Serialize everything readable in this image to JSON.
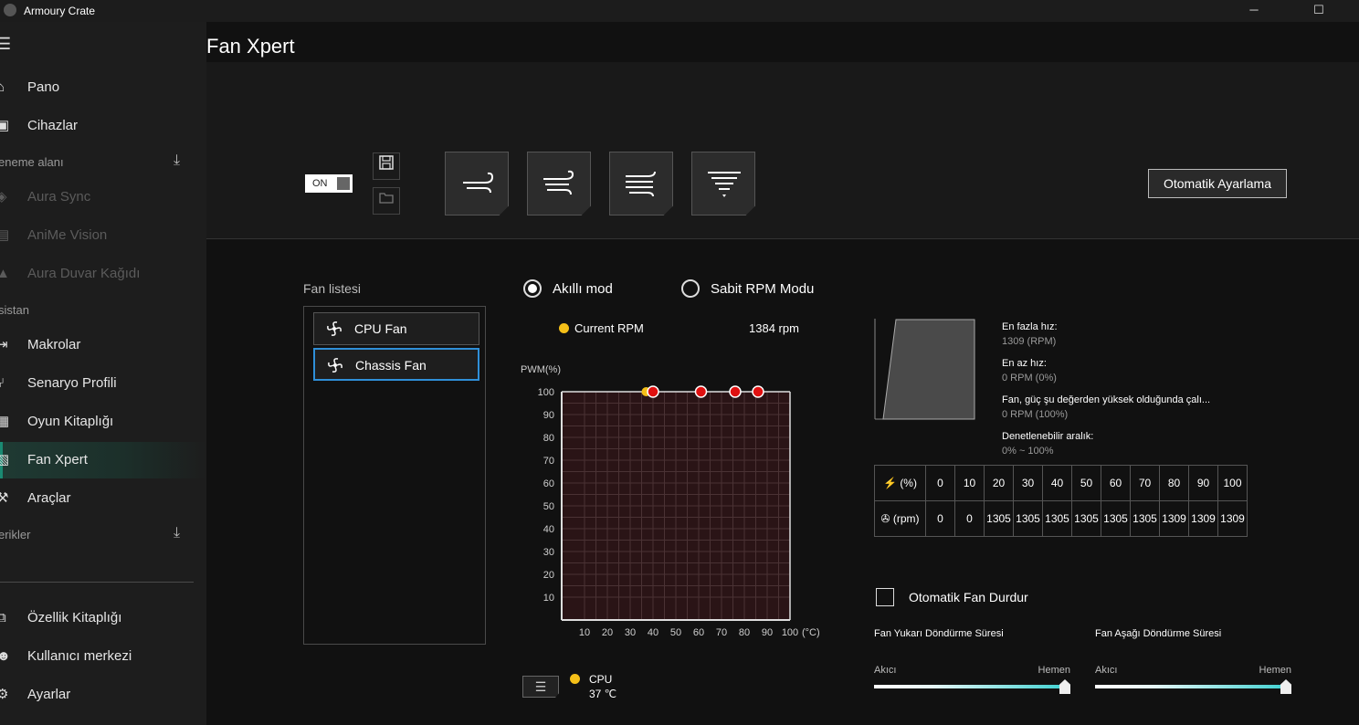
{
  "titlebar": {
    "app_title": "Armoury Crate",
    "minimize": "─",
    "maximize": "☐",
    "close": "✕"
  },
  "sidebar": {
    "items": [
      {
        "label": "Pano",
        "icon": "home-icon",
        "disabled": false
      },
      {
        "label": "Cihazlar",
        "icon": "devices-icon",
        "disabled": false
      },
      {
        "label": "Aura Sync",
        "icon": "aura-icon",
        "disabled": true
      },
      {
        "label": "AniMe Vision",
        "icon": "anime-icon",
        "disabled": true
      },
      {
        "label": "Aura Duvar Kağıdı",
        "icon": "wallpaper-icon",
        "disabled": true
      },
      {
        "label": "Makrolar",
        "icon": "macro-icon",
        "disabled": false
      },
      {
        "label": "Senaryo Profili",
        "icon": "scenario-icon",
        "disabled": false
      },
      {
        "label": "Oyun Kitaplığı",
        "icon": "game-library-icon",
        "disabled": false
      },
      {
        "label": "Fan Xpert",
        "icon": "fan-xpert-icon",
        "disabled": false,
        "active": true
      },
      {
        "label": "Araçlar",
        "icon": "tools-icon",
        "disabled": false
      },
      {
        "label": "Özellik Kitaplığı",
        "icon": "feature-library-icon",
        "disabled": false
      },
      {
        "label": "Kullanıcı merkezi",
        "icon": "user-center-icon",
        "disabled": false
      },
      {
        "label": "Ayarlar",
        "icon": "settings-icon",
        "disabled": false
      }
    ],
    "sections": {
      "deneme": "eneme alanı",
      "asistan": "sistan",
      "icerikler": "erikler"
    }
  },
  "page": {
    "title": "Fan Xpert"
  },
  "controls": {
    "toggle_label": "ON",
    "auto_tune_label": "Otomatik Ayarlama",
    "mode_buttons": [
      "silent-mode-icon",
      "standard-mode-icon",
      "turbo-mode-icon",
      "full-speed-mode-icon"
    ]
  },
  "fan_list": {
    "label": "Fan listesi",
    "items": [
      "CPU Fan",
      "Chassis Fan"
    ],
    "selected": "Chassis Fan"
  },
  "modes": {
    "smart": "Akıllı mod",
    "fixed": "Sabit RPM Modu",
    "selected": "smart"
  },
  "current": {
    "label": "Current RPM",
    "value": "1384 rpm",
    "dot_color": "#f5c018"
  },
  "chart_data": {
    "type": "line",
    "ylabel": "PWM(%)",
    "xlabel": "(°C)",
    "x_ticks": [
      10,
      20,
      30,
      40,
      50,
      60,
      70,
      80,
      90,
      100
    ],
    "y_ticks": [
      10,
      20,
      30,
      40,
      50,
      60,
      70,
      80,
      90,
      100
    ],
    "xlim": [
      0,
      100
    ],
    "ylim": [
      0,
      100
    ],
    "points": [
      {
        "x": 40,
        "y": 100
      },
      {
        "x": 61,
        "y": 100
      },
      {
        "x": 76,
        "y": 100
      },
      {
        "x": 86,
        "y": 100
      }
    ],
    "current_marker": {
      "x": 37,
      "y": 100
    },
    "grid": true,
    "point_color": "#e01010",
    "current_color": "#f5c018",
    "plot_bg": "#2a1416"
  },
  "sensor": {
    "name": "CPU",
    "temp": "37 ℃",
    "dot_color": "#f5c018"
  },
  "info": [
    {
      "title": "En fazla hız:",
      "value": "1309 (RPM)"
    },
    {
      "title": "En az hız:",
      "value": "0 RPM (0%)"
    },
    {
      "title": "Fan, güç şu değerden yüksek olduğunda çalı...",
      "value": "0 RPM (100%)"
    },
    {
      "title": "Denetlenebilir aralık:",
      "value": "0% ~ 100%"
    }
  ],
  "rpm_table": {
    "row1_label": "(%)",
    "row2_label": "(rpm)",
    "percents": [
      "0",
      "10",
      "20",
      "30",
      "40",
      "50",
      "60",
      "70",
      "80",
      "90",
      "100"
    ],
    "rpms": [
      "0",
      "0",
      "1305",
      "1305",
      "1305",
      "1305",
      "1305",
      "1305",
      "1309",
      "1309",
      "1309"
    ]
  },
  "auto_stop": {
    "label": "Otomatik Fan Durdur",
    "checked": false
  },
  "spin_up": {
    "title": "Fan Yukarı Döndürme Süresi",
    "min": "Akıcı",
    "max": "Hemen",
    "value_fraction": 1.0
  },
  "spin_down": {
    "title": "Fan Aşağı Döndürme Süresi",
    "min": "Akıcı",
    "max": "Hemen",
    "value_fraction": 1.0
  }
}
